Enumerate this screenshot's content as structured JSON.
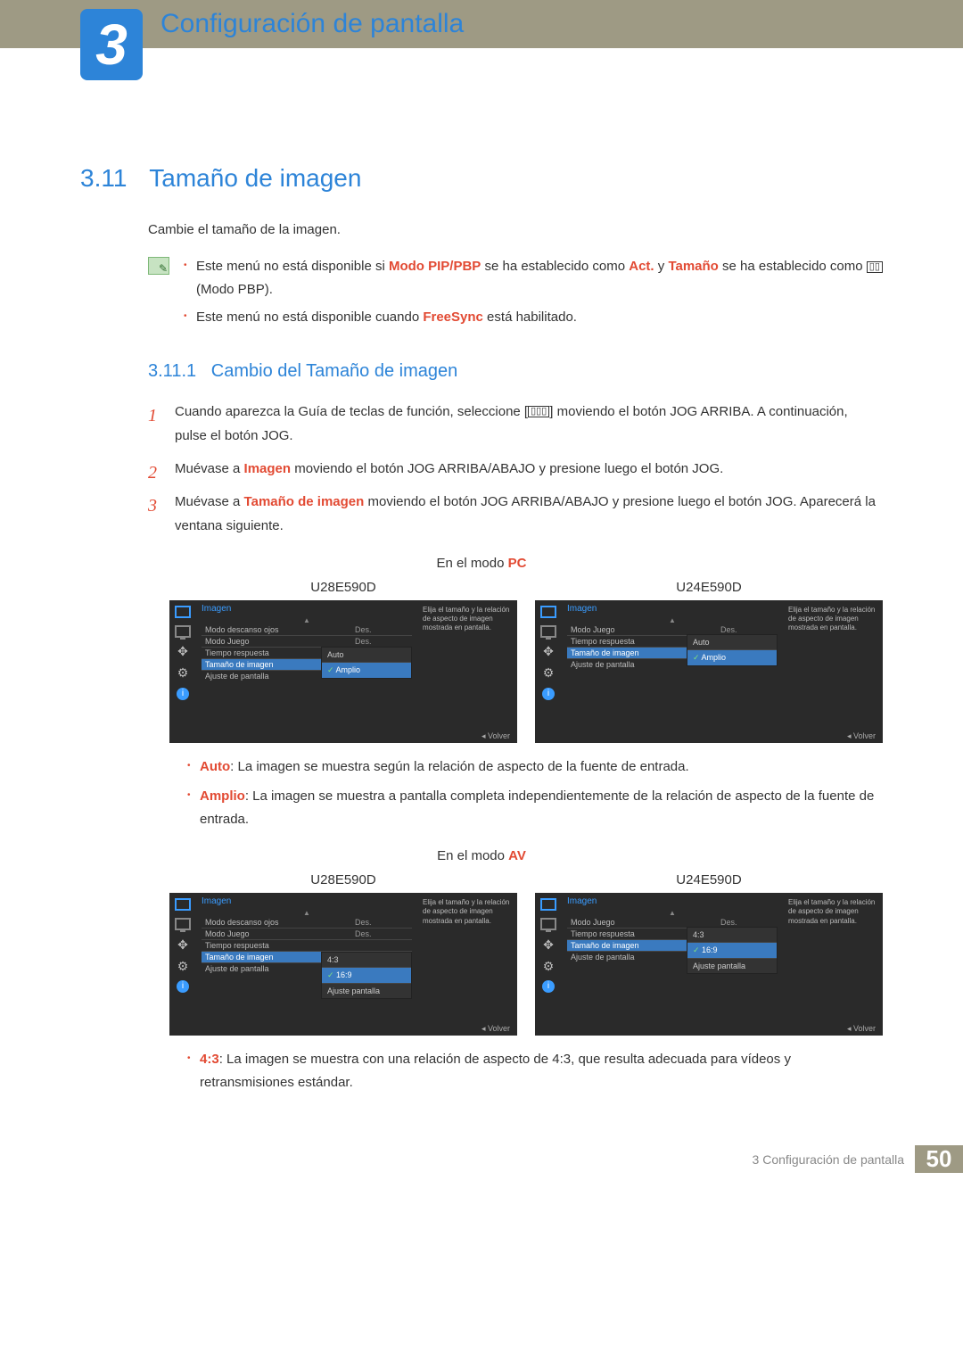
{
  "chapter": {
    "number": "3",
    "title": "Configuración de pantalla"
  },
  "section": {
    "number": "3.11",
    "title": "Tamaño de imagen"
  },
  "intro": "Cambie el tamaño de la imagen.",
  "notes": {
    "n1_a": "Este menú no está disponible si ",
    "n1_b": "Modo PIP/PBP",
    "n1_c": " se ha establecido como ",
    "n1_d": "Act.",
    "n1_e": " y ",
    "n1_f": "Tamaño",
    "n1_g": " se ha establecido como ",
    "n1_icon": "▯▯",
    "n1_h": " (Modo PBP).",
    "n2_a": "Este menú no está disponible cuando ",
    "n2_b": "FreeSync",
    "n2_c": " está habilitado."
  },
  "subsection": {
    "number": "3.11.1",
    "title": "Cambio del Tamaño de imagen"
  },
  "steps": {
    "s1_a": "Cuando aparezca la Guía de teclas de función, seleccione [",
    "s1_icon": "▯▯▯",
    "s1_b": "] moviendo el botón JOG ARRIBA. A continuación, pulse el botón JOG.",
    "s2_a": "Muévase a ",
    "s2_b": "Imagen",
    "s2_c": " moviendo el botón JOG ARRIBA/ABAJO y presione luego el botón JOG.",
    "s3_a": "Muévase a ",
    "s3_b": "Tamaño de imagen",
    "s3_c": " moviendo el botón JOG ARRIBA/ABAJO y presione luego el botón JOG. Aparecerá la ventana siguiente."
  },
  "mode_pc": {
    "prefix": "En el modo ",
    "mode": "PC"
  },
  "mode_av": {
    "prefix": "En el modo ",
    "mode": "AV"
  },
  "models": {
    "a": "U28E590D",
    "b": "U24E590D"
  },
  "osd": {
    "title": "Imagen",
    "hint": "Elija el tamaño y la relación de aspecto de imagen mostrada en pantalla.",
    "back": "Volver",
    "up": "▲",
    "items_a": {
      "i1": "Modo descanso ojos",
      "i1v": "Des.",
      "i2": "Modo Juego",
      "i2v": "Des.",
      "i3": "Tiempo respuesta",
      "i4": "Tamaño de imagen",
      "i5": "Ajuste de pantalla"
    },
    "items_b": {
      "i1": "Modo Juego",
      "i1v": "Des.",
      "i2": "Tiempo respuesta",
      "i3": "Tamaño de imagen",
      "i4": "Ajuste de pantalla"
    },
    "pc_sub": {
      "o1": "Auto",
      "o2": "Amplio"
    },
    "av_sub": {
      "o1": "4:3",
      "o2": "16:9",
      "o3": "Ajuste pantalla"
    }
  },
  "pc_bullets": {
    "b1_a": "Auto",
    "b1_b": ": La imagen se muestra según la relación de aspecto de la fuente de entrada.",
    "b2_a": "Amplio",
    "b2_b": ": La imagen se muestra a pantalla completa independientemente de la relación de aspecto de la fuente de entrada."
  },
  "av_bullets": {
    "b1_a": "4:3",
    "b1_b": ": La imagen se muestra con una relación de aspecto de 4:3, que resulta adecuada para vídeos y retransmisiones estándar."
  },
  "footer": {
    "text": "3 Configuración de pantalla",
    "page": "50"
  }
}
